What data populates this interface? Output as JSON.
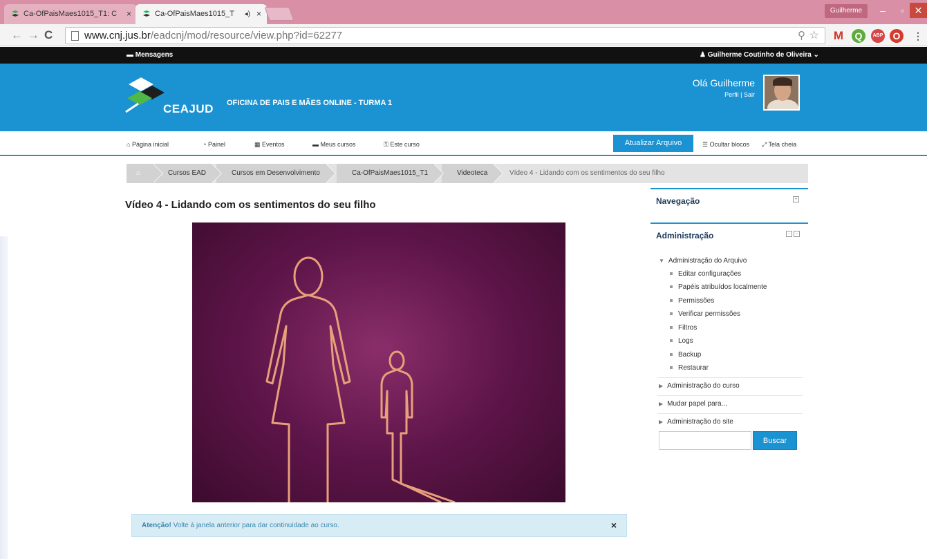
{
  "browser": {
    "tabs": [
      {
        "title": "Ca-OfPaisMaes1015_T1: C"
      },
      {
        "title": "Ca-OfPaisMaes1015_T"
      }
    ],
    "tab_close": "×",
    "tab_audio": "◂)",
    "profile_name": "Guilherme",
    "url_host": "www.cnj.jus.br",
    "url_path": "/eadcnj/mod/resource/view.php?id=62277"
  },
  "topbar": {
    "messages": "Mensagens",
    "user_name": "Guilherme Coutinho de Oliveira"
  },
  "header": {
    "logo_text": "CEAJUD",
    "course_title": "OFICINA DE PAIS E MÃES ONLINE - TURMA 1",
    "greeting": "Olá Guilherme",
    "profile_link": "Perfil",
    "link_separator": "|",
    "logout_link": "Sair"
  },
  "nav": {
    "items": [
      {
        "label": "Página inicial",
        "icon": "home-icon"
      },
      {
        "label": "Painel",
        "icon": "dashboard-icon"
      },
      {
        "label": "Eventos",
        "icon": "calendar-icon"
      },
      {
        "label": "Meus cursos",
        "icon": "courses-icon"
      },
      {
        "label": "Este curso",
        "icon": "sitemap-icon"
      }
    ],
    "update_button": "Atualizar Arquivo",
    "hide_blocks": "Ocultar blocos",
    "fullscreen": "Tela cheia"
  },
  "breadcrumb": [
    "Cursos EAD",
    "Cursos em Desenvolvimento",
    "Ca-OfPaisMaes1015_T1",
    "Videoteca",
    "Vídeo 4 - Lidando com os sentimentos do seu filho"
  ],
  "main": {
    "title": "Vídeo 4 - Lidando com os sentimentos do seu filho",
    "alert_strong": "Atenção!",
    "alert_text": "Volte à janela anterior para dar continuidade ao curso.",
    "alert_close": "×"
  },
  "blocks": {
    "navigation_title": "Navegação",
    "admin_title": "Administração",
    "file_admin": "Administração do Arquivo",
    "file_admin_items": [
      "Editar configurações",
      "Papéis atribuídos localmente",
      "Permissões",
      "Verificar permissões",
      "Filtros",
      "Logs",
      "Backup",
      "Restaurar"
    ],
    "course_admin": "Administração do curso",
    "switch_role": "Mudar papel para...",
    "site_admin": "Administração do site",
    "search_button": "Buscar"
  },
  "colors": {
    "brand_blue": "#1b92d1",
    "tab_strip": "#d98fa6",
    "video_bg": "#5e1549"
  }
}
